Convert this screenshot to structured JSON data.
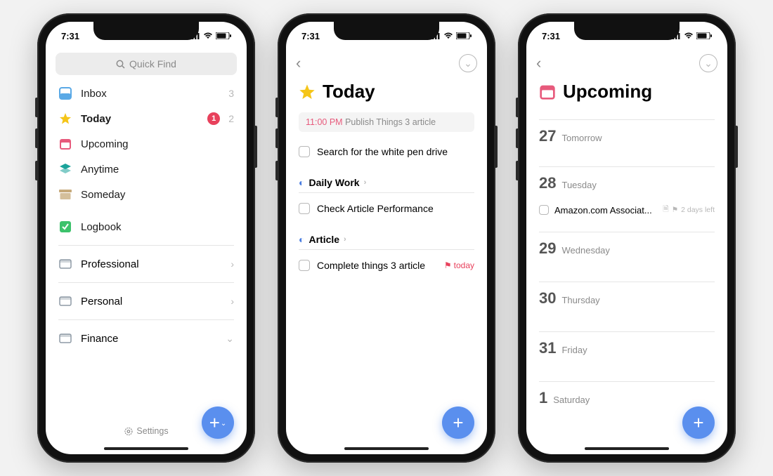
{
  "status": {
    "time": "7:31"
  },
  "sidebar": {
    "search_placeholder": "Quick Find",
    "items": [
      {
        "icon": "inbox",
        "label": "Inbox",
        "count": "3",
        "badge": ""
      },
      {
        "icon": "star",
        "label": "Today",
        "count": "2",
        "badge": "1"
      },
      {
        "icon": "calendar",
        "label": "Upcoming",
        "count": "",
        "badge": ""
      },
      {
        "icon": "stack",
        "label": "Anytime",
        "count": "",
        "badge": ""
      },
      {
        "icon": "archive",
        "label": "Someday",
        "count": "",
        "badge": ""
      },
      {
        "icon": "logbook",
        "label": "Logbook",
        "count": "",
        "badge": ""
      }
    ],
    "areas": [
      {
        "label": "Professional",
        "chevron": "right"
      },
      {
        "label": "Personal",
        "chevron": "right"
      },
      {
        "label": "Finance",
        "chevron": "down"
      }
    ],
    "settings_label": "Settings"
  },
  "today": {
    "title": "Today",
    "event": {
      "time": "11:00 PM",
      "title": "Publish Things 3 article"
    },
    "ungrouped_tasks": [
      {
        "label": "Search for the white pen drive"
      }
    ],
    "sections": [
      {
        "title": "Daily Work",
        "tasks": [
          {
            "label": "Check Article Performance",
            "flag": ""
          }
        ]
      },
      {
        "title": "Article",
        "tasks": [
          {
            "label": "Complete things 3 article",
            "flag": "today"
          }
        ]
      }
    ]
  },
  "upcoming": {
    "title": "Upcoming",
    "days": [
      {
        "num": "27",
        "name": "Tomorrow",
        "tasks": []
      },
      {
        "num": "28",
        "name": "Tuesday",
        "tasks": [
          {
            "label": "Amazon.com Associat...",
            "meta": "2 days left"
          }
        ]
      },
      {
        "num": "29",
        "name": "Wednesday",
        "tasks": []
      },
      {
        "num": "30",
        "name": "Thursday",
        "tasks": []
      },
      {
        "num": "31",
        "name": "Friday",
        "tasks": []
      },
      {
        "num": "1",
        "name": "Saturday",
        "tasks": []
      }
    ]
  }
}
